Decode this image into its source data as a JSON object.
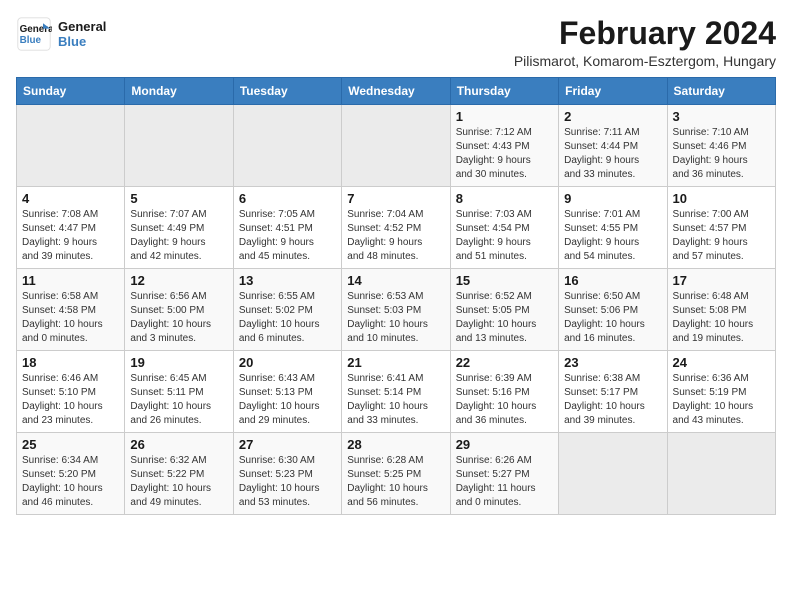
{
  "logo": {
    "line1": "General",
    "line2": "Blue"
  },
  "title": "February 2024",
  "subtitle": "Pilismarot, Komarom-Esztergom, Hungary",
  "days_of_week": [
    "Sunday",
    "Monday",
    "Tuesday",
    "Wednesday",
    "Thursday",
    "Friday",
    "Saturday"
  ],
  "weeks": [
    [
      {
        "day": "",
        "info": ""
      },
      {
        "day": "",
        "info": ""
      },
      {
        "day": "",
        "info": ""
      },
      {
        "day": "",
        "info": ""
      },
      {
        "day": "1",
        "info": "Sunrise: 7:12 AM\nSunset: 4:43 PM\nDaylight: 9 hours\nand 30 minutes."
      },
      {
        "day": "2",
        "info": "Sunrise: 7:11 AM\nSunset: 4:44 PM\nDaylight: 9 hours\nand 33 minutes."
      },
      {
        "day": "3",
        "info": "Sunrise: 7:10 AM\nSunset: 4:46 PM\nDaylight: 9 hours\nand 36 minutes."
      }
    ],
    [
      {
        "day": "4",
        "info": "Sunrise: 7:08 AM\nSunset: 4:47 PM\nDaylight: 9 hours\nand 39 minutes."
      },
      {
        "day": "5",
        "info": "Sunrise: 7:07 AM\nSunset: 4:49 PM\nDaylight: 9 hours\nand 42 minutes."
      },
      {
        "day": "6",
        "info": "Sunrise: 7:05 AM\nSunset: 4:51 PM\nDaylight: 9 hours\nand 45 minutes."
      },
      {
        "day": "7",
        "info": "Sunrise: 7:04 AM\nSunset: 4:52 PM\nDaylight: 9 hours\nand 48 minutes."
      },
      {
        "day": "8",
        "info": "Sunrise: 7:03 AM\nSunset: 4:54 PM\nDaylight: 9 hours\nand 51 minutes."
      },
      {
        "day": "9",
        "info": "Sunrise: 7:01 AM\nSunset: 4:55 PM\nDaylight: 9 hours\nand 54 minutes."
      },
      {
        "day": "10",
        "info": "Sunrise: 7:00 AM\nSunset: 4:57 PM\nDaylight: 9 hours\nand 57 minutes."
      }
    ],
    [
      {
        "day": "11",
        "info": "Sunrise: 6:58 AM\nSunset: 4:58 PM\nDaylight: 10 hours\nand 0 minutes."
      },
      {
        "day": "12",
        "info": "Sunrise: 6:56 AM\nSunset: 5:00 PM\nDaylight: 10 hours\nand 3 minutes."
      },
      {
        "day": "13",
        "info": "Sunrise: 6:55 AM\nSunset: 5:02 PM\nDaylight: 10 hours\nand 6 minutes."
      },
      {
        "day": "14",
        "info": "Sunrise: 6:53 AM\nSunset: 5:03 PM\nDaylight: 10 hours\nand 10 minutes."
      },
      {
        "day": "15",
        "info": "Sunrise: 6:52 AM\nSunset: 5:05 PM\nDaylight: 10 hours\nand 13 minutes."
      },
      {
        "day": "16",
        "info": "Sunrise: 6:50 AM\nSunset: 5:06 PM\nDaylight: 10 hours\nand 16 minutes."
      },
      {
        "day": "17",
        "info": "Sunrise: 6:48 AM\nSunset: 5:08 PM\nDaylight: 10 hours\nand 19 minutes."
      }
    ],
    [
      {
        "day": "18",
        "info": "Sunrise: 6:46 AM\nSunset: 5:10 PM\nDaylight: 10 hours\nand 23 minutes."
      },
      {
        "day": "19",
        "info": "Sunrise: 6:45 AM\nSunset: 5:11 PM\nDaylight: 10 hours\nand 26 minutes."
      },
      {
        "day": "20",
        "info": "Sunrise: 6:43 AM\nSunset: 5:13 PM\nDaylight: 10 hours\nand 29 minutes."
      },
      {
        "day": "21",
        "info": "Sunrise: 6:41 AM\nSunset: 5:14 PM\nDaylight: 10 hours\nand 33 minutes."
      },
      {
        "day": "22",
        "info": "Sunrise: 6:39 AM\nSunset: 5:16 PM\nDaylight: 10 hours\nand 36 minutes."
      },
      {
        "day": "23",
        "info": "Sunrise: 6:38 AM\nSunset: 5:17 PM\nDaylight: 10 hours\nand 39 minutes."
      },
      {
        "day": "24",
        "info": "Sunrise: 6:36 AM\nSunset: 5:19 PM\nDaylight: 10 hours\nand 43 minutes."
      }
    ],
    [
      {
        "day": "25",
        "info": "Sunrise: 6:34 AM\nSunset: 5:20 PM\nDaylight: 10 hours\nand 46 minutes."
      },
      {
        "day": "26",
        "info": "Sunrise: 6:32 AM\nSunset: 5:22 PM\nDaylight: 10 hours\nand 49 minutes."
      },
      {
        "day": "27",
        "info": "Sunrise: 6:30 AM\nSunset: 5:23 PM\nDaylight: 10 hours\nand 53 minutes."
      },
      {
        "day": "28",
        "info": "Sunrise: 6:28 AM\nSunset: 5:25 PM\nDaylight: 10 hours\nand 56 minutes."
      },
      {
        "day": "29",
        "info": "Sunrise: 6:26 AM\nSunset: 5:27 PM\nDaylight: 11 hours\nand 0 minutes."
      },
      {
        "day": "",
        "info": ""
      },
      {
        "day": "",
        "info": ""
      }
    ]
  ]
}
